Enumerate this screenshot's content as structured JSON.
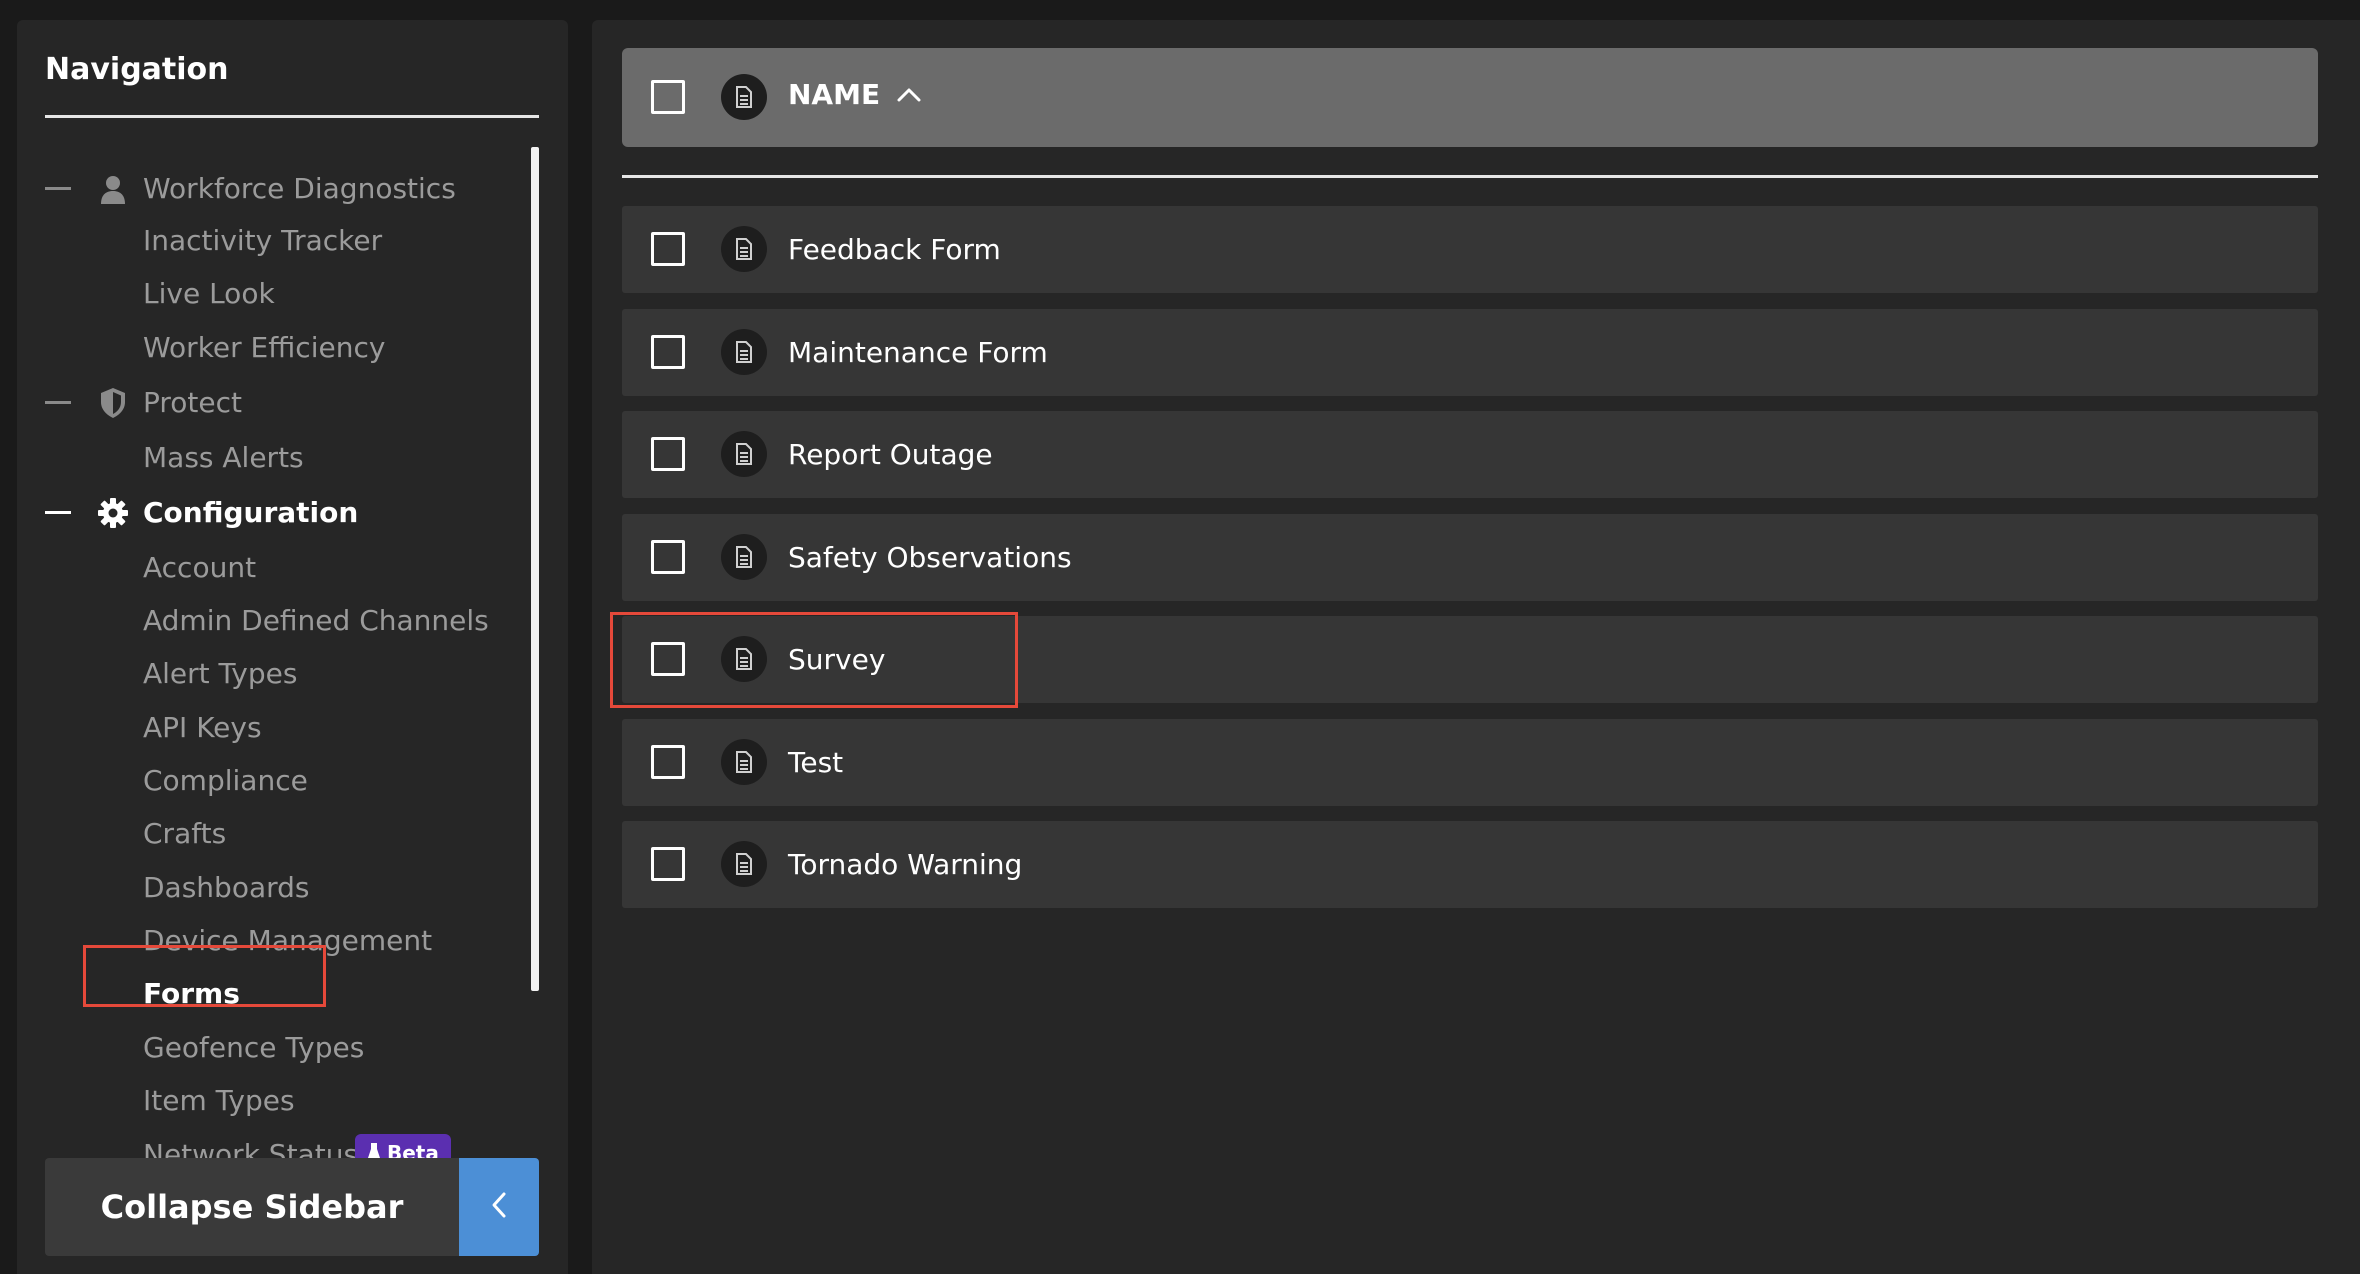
{
  "sidebar": {
    "title": "Navigation",
    "sections": {
      "workforce": "Workforce Diagnostics",
      "protect": "Protect",
      "configuration": "Configuration"
    },
    "items": {
      "inactivity_tracker": "Inactivity Tracker",
      "live_look": "Live Look",
      "worker_efficiency": "Worker Efficiency",
      "mass_alerts": "Mass Alerts",
      "account": "Account",
      "admin_defined_channels": "Admin Defined Channels",
      "alert_types": "Alert Types",
      "api_keys": "API Keys",
      "compliance": "Compliance",
      "crafts": "Crafts",
      "dashboards": "Dashboards",
      "device_management": "Device Management",
      "forms": "Forms",
      "geofence_types": "Geofence Types",
      "item_types": "Item Types",
      "network_status": "Network Status"
    },
    "beta_label": "Beta",
    "collapse_label": "Collapse Sidebar"
  },
  "table": {
    "header_label": "NAME",
    "rows": [
      "Feedback Form",
      "Maintenance Form",
      "Report Outage",
      "Safety Observations",
      "Survey",
      "Test",
      "Tornado Warning"
    ]
  },
  "colors": {
    "accent_blue": "#4c8fd6",
    "highlight_red": "#e5493a",
    "beta_purple": "#5b2fb0"
  }
}
